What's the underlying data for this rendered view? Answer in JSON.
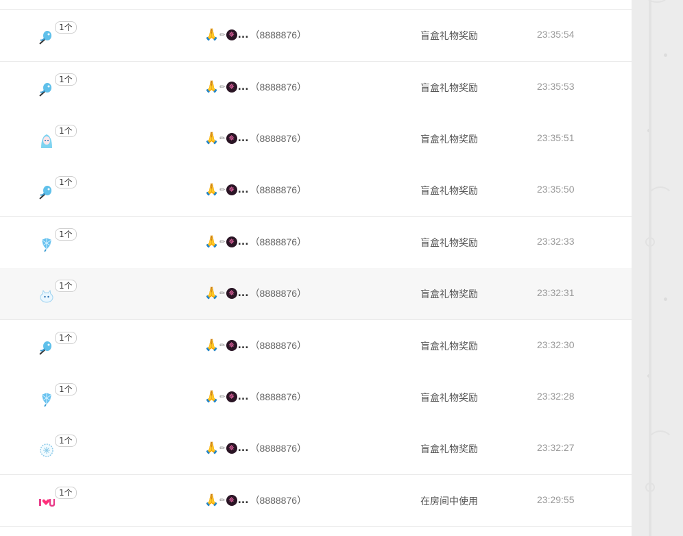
{
  "records": [
    {
      "gift_icon": "blue-bird-icon",
      "count": "1个",
      "user_emoji": "🙏",
      "user_decor": "✏",
      "user_badge": "✵",
      "ellipsis": "...",
      "user_id": "（8888876）",
      "source": "盲盒礼物奖励",
      "time": "23:35:54"
    },
    {
      "gift_icon": "blue-bird-icon",
      "count": "1个",
      "user_emoji": "🙏",
      "user_decor": "✏",
      "user_badge": "✵",
      "ellipsis": "...",
      "user_id": "（8888876）",
      "source": "盲盒礼物奖励",
      "time": "23:35:53"
    },
    {
      "gift_icon": "anime-girl-icon",
      "count": "1个",
      "user_emoji": "🙏",
      "user_decor": "✏",
      "user_badge": "✵",
      "ellipsis": "...",
      "user_id": "（8888876）",
      "source": "盲盒礼物奖励",
      "time": "23:35:51"
    },
    {
      "gift_icon": "blue-bird-icon",
      "count": "1个",
      "user_emoji": "🙏",
      "user_decor": "✏",
      "user_badge": "✵",
      "ellipsis": "...",
      "user_id": "（8888876）",
      "source": "盲盒礼物奖励",
      "time": "23:35:50"
    },
    {
      "gift_icon": "ice-crystal-icon",
      "count": "1个",
      "user_emoji": "🙏",
      "user_decor": "✏",
      "user_badge": "✵",
      "ellipsis": "...",
      "user_id": "（8888876）",
      "source": "盲盒礼物奖励",
      "time": "23:32:33"
    },
    {
      "gift_icon": "snow-cat-icon",
      "count": "1个",
      "user_emoji": "🙏",
      "user_decor": "✏",
      "user_badge": "✵",
      "ellipsis": "...",
      "user_id": "（8888876）",
      "source": "盲盒礼物奖励",
      "time": "23:32:31"
    },
    {
      "gift_icon": "blue-bird-icon",
      "count": "1个",
      "user_emoji": "🙏",
      "user_decor": "✏",
      "user_badge": "✵",
      "ellipsis": "...",
      "user_id": "（8888876）",
      "source": "盲盒礼物奖励",
      "time": "23:32:30"
    },
    {
      "gift_icon": "ice-crystal-icon",
      "count": "1个",
      "user_emoji": "🙏",
      "user_decor": "✏",
      "user_badge": "✵",
      "ellipsis": "...",
      "user_id": "（8888876）",
      "source": "盲盒礼物奖励",
      "time": "23:32:28"
    },
    {
      "gift_icon": "snow-bubble-icon",
      "count": "1个",
      "user_emoji": "🙏",
      "user_decor": "✏",
      "user_badge": "✵",
      "ellipsis": "...",
      "user_id": "（8888876）",
      "source": "盲盒礼物奖励",
      "time": "23:32:27"
    },
    {
      "gift_icon": "i-love-u-icon",
      "count": "1个",
      "user_emoji": "🙏",
      "user_decor": "✏",
      "user_badge": "✵",
      "ellipsis": "...",
      "user_id": "（8888876）",
      "source": "在房间中使用",
      "time": "23:29:55"
    }
  ],
  "colors": {
    "divider": "#e8e8e8",
    "row_highlight": "#f7f7f7",
    "text_primary": "#555555",
    "text_muted": "#999999",
    "side_panel": "#ececec"
  }
}
